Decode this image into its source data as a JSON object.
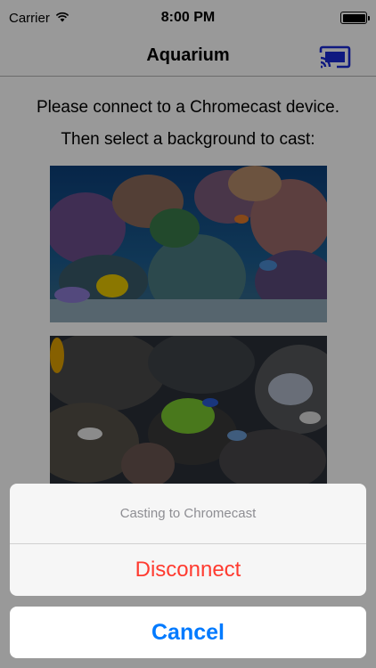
{
  "status_bar": {
    "carrier": "Carrier",
    "time": "8:00 PM",
    "wifi_icon": "wifi-icon",
    "battery_icon": "battery-full-icon"
  },
  "nav": {
    "title": "Aquarium",
    "cast_icon": "cast-connected-icon"
  },
  "content": {
    "instruction_line1": "Please connect to a Chromecast device.",
    "instruction_line2": "Then select a background to cast:",
    "backgrounds": [
      {
        "name": "coral-reef-background"
      },
      {
        "name": "reef-rocks-background"
      }
    ]
  },
  "action_sheet": {
    "title": "Casting to Chromecast",
    "destructive_label": "Disconnect",
    "cancel_label": "Cancel"
  },
  "colors": {
    "ios_blue": "#007aff",
    "cast_blue": "#1a2bd6",
    "destructive_red": "#ff3b30",
    "sheet_title_gray": "#8e8e93"
  }
}
